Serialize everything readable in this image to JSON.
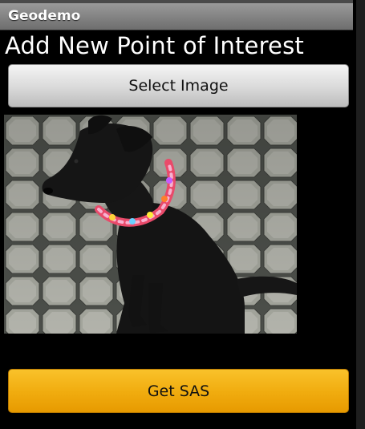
{
  "app": {
    "title": "Geodemo"
  },
  "page": {
    "heading": "Add New Point of Interest"
  },
  "buttons": {
    "select_image": "Select Image",
    "get_sas": "Get SAS"
  },
  "photo": {
    "subject": "black dog with lei on paving stones"
  },
  "colors": {
    "titlebar": "#8a8a8a",
    "accent_button": "#f1ad10",
    "background": "#000000"
  }
}
